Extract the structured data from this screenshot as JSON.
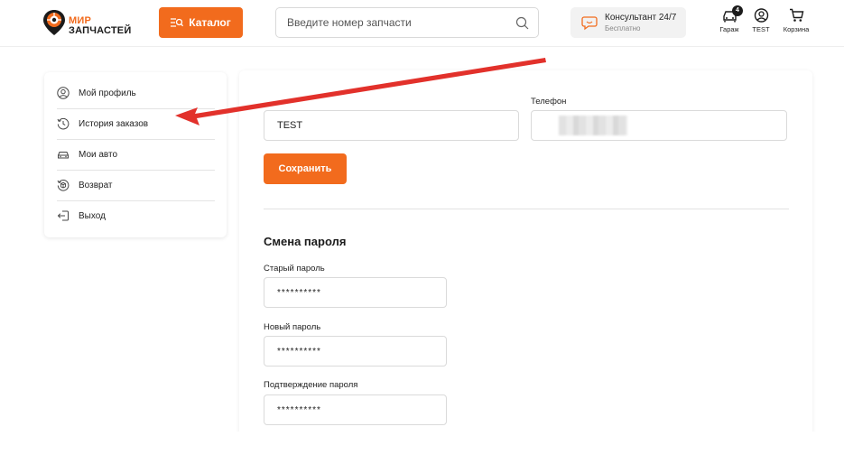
{
  "header": {
    "logo": {
      "line1": "МИР",
      "line2": "ЗАПЧАСТЕЙ"
    },
    "catalog_label": "Каталог",
    "search": {
      "placeholder": "Введите номер запчасти",
      "value": ""
    },
    "consultant": {
      "title": "Консультант 24/7",
      "subtitle": "Бесплатно"
    },
    "garage": {
      "label": "Гараж",
      "count": "4"
    },
    "user": {
      "label": "TEST"
    },
    "cart": {
      "label": "Корзина"
    }
  },
  "sidebar": {
    "items": [
      {
        "label": "Мой профиль",
        "icon": "user-circle-icon"
      },
      {
        "label": "История заказов",
        "icon": "history-icon"
      },
      {
        "label": "Мои авто",
        "icon": "car-icon"
      },
      {
        "label": "Возврат",
        "icon": "return-box-icon"
      },
      {
        "label": "Выход",
        "icon": "logout-icon"
      }
    ]
  },
  "profile": {
    "name_value": "TEST",
    "phone_label": "Телефон",
    "save_label": "Сохранить"
  },
  "password": {
    "title": "Смена пароля",
    "old_label": "Старый пароль",
    "old_value": "**********",
    "new_label": "Новый пароль",
    "new_value": "**********",
    "confirm_label": "Подтверждение пароля",
    "confirm_value": "**********"
  },
  "colors": {
    "accent": "#f26b1d",
    "annotation_arrow": "#e2312b",
    "text": "#222222"
  }
}
